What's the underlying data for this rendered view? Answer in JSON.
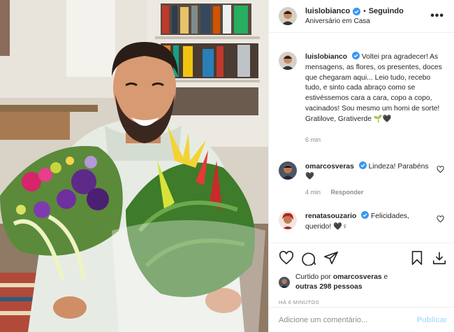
{
  "post": {
    "author": "luislobianco",
    "follow_label": "Seguindo",
    "separator": "•",
    "location": "Aniversário em Casa",
    "more_label": "•••"
  },
  "caption": {
    "username": "luislobianco",
    "text": "Voltei pra agradecer! As mensagens, as flores, os presentes, doces que chegaram aqui... Leio tudo, recebo tudo, e sinto cada abraço como se estivéssemos cara a cara, copo a copo, vacinados! Sou mesmo um homi de sorte! Gratilove, Grativerde 🌱🖤",
    "time": "6 min"
  },
  "comments": [
    {
      "username": "omarcosveras",
      "text": "Lindeza! Parabéns 🖤",
      "time": "4 min",
      "reply_label": "Responder"
    },
    {
      "username": "renatasouzario",
      "text": "Felicidades, querido! 🖤♀"
    }
  ],
  "likes": {
    "prefix": "Curtido por",
    "first_user": "omarcosveras",
    "connector": "e",
    "others": "outras 298 pessoas"
  },
  "timestamp": "HÁ 6 MINUTOS",
  "add_comment": {
    "placeholder": "Adicione um comentário...",
    "publish_label": "Publicar"
  },
  "colors": {
    "verified": "#3897f0",
    "publish_disabled": "#b2dffc",
    "meta_gray": "#8e8e8e"
  },
  "icons": [
    "heart-icon",
    "comment-icon",
    "share-icon",
    "bookmark-icon",
    "download-icon",
    "verified-badge-icon",
    "more-options-icon"
  ]
}
